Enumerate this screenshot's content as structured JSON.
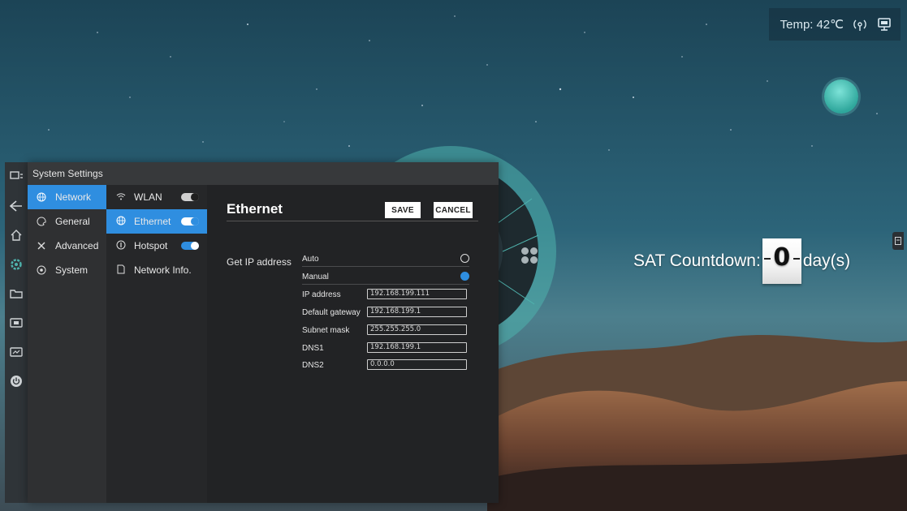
{
  "status": {
    "temp_label": "Temp:",
    "temp_value": "42℃",
    "icons": [
      "signal-icon",
      "screen-icon"
    ]
  },
  "dock": {
    "icons": [
      "window-icon",
      "back-icon",
      "home-icon",
      "settings-icon",
      "folder-icon",
      "input-source-icon",
      "screenshot-icon",
      "power-icon"
    ]
  },
  "settings": {
    "title": "System Settings",
    "menu": [
      {
        "label": "Network",
        "icon": "globe-icon",
        "active": true
      },
      {
        "label": "General",
        "icon": "palette-icon",
        "active": false
      },
      {
        "label": "Advanced",
        "icon": "tools-icon",
        "active": false
      },
      {
        "label": "System",
        "icon": "info-icon",
        "active": false
      }
    ],
    "submenu": [
      {
        "label": "WLAN",
        "icon": "wifi-icon",
        "toggle": "off",
        "active": false
      },
      {
        "label": "Ethernet",
        "icon": "globe-icon",
        "toggle": "on",
        "active": true
      },
      {
        "label": "Hotspot",
        "icon": "hotspot-icon",
        "toggle": "on",
        "active": false
      },
      {
        "label": "Network Info.",
        "icon": "document-icon",
        "toggle": null,
        "active": false
      }
    ],
    "panel": {
      "title": "Ethernet",
      "save_label": "SAVE",
      "cancel_label": "CANCEL",
      "ip_label": "Get IP address",
      "options": [
        {
          "label": "Auto",
          "selected": false
        },
        {
          "label": "Manual",
          "selected": true
        }
      ],
      "fields": [
        {
          "label": "IP address",
          "value": "192.168.199.111"
        },
        {
          "label": "Default gateway",
          "value": "192.168.199.1"
        },
        {
          "label": "Subnet mask",
          "value": "255.255.255.0"
        },
        {
          "label": "DNS1",
          "value": "192.168.199.1"
        },
        {
          "label": "DNS2",
          "value": "0.0.0.0"
        }
      ]
    }
  },
  "countdown": {
    "prefix": "SAT Countdown:",
    "digit": "0",
    "suffix": "day(s)"
  },
  "colors": {
    "accent": "#2f8ee0",
    "panel_bg": "#2a2b2d",
    "ring": "#4fb3ad"
  }
}
